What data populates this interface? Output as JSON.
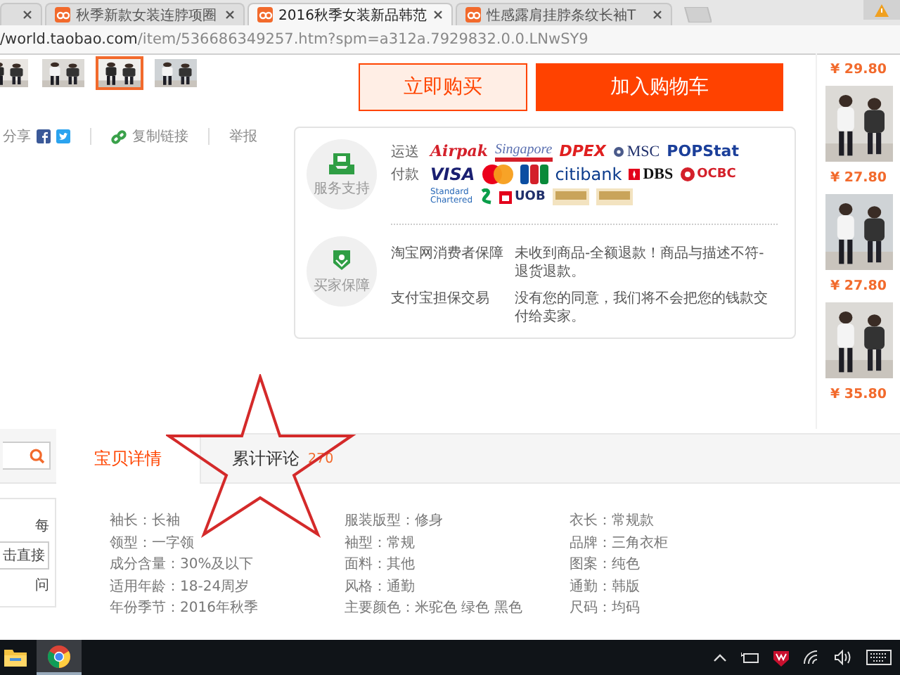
{
  "browser": {
    "tabs": [
      {
        "selected": false
      },
      {
        "label": "秋季新款女装连脖项圈",
        "selected": false
      },
      {
        "label": "2016秋季女装新品韩范",
        "selected": true
      },
      {
        "label": "性感露肩挂脖条纹长袖T",
        "selected": false
      }
    ],
    "address": {
      "host": "/world.taobao.com",
      "path": "/item/536686349257.htm?spm=a312a.7929832.0.0.LNwSY9"
    }
  },
  "thumbnails": [
    {
      "kind": "picture",
      "selected": false
    },
    {
      "kind": "picture",
      "selected": false
    },
    {
      "kind": "picture",
      "selected": true
    },
    {
      "kind": "picture",
      "selected": false
    }
  ],
  "share": {
    "label": "分享",
    "copy_link": "复制链接",
    "report": "举报"
  },
  "buy_buttons": [
    {
      "kind": "outline",
      "label": "立即购买"
    },
    {
      "kind": "solid",
      "label": "加入购物车"
    }
  ],
  "service": {
    "support_label": "服务支持",
    "shipping_label": "运送",
    "shipping_logos": [
      {
        "kind": "airpak",
        "label": "Airpak"
      },
      {
        "kind": "singapore",
        "label": "Singapore"
      },
      {
        "kind": "dpex",
        "label": "DPEX"
      },
      {
        "kind": "msc",
        "label": "MSC"
      },
      {
        "kind": "popstat",
        "label": "POPStat"
      }
    ],
    "payment_label": "付款",
    "payment_logos": [
      {
        "kind": "visa",
        "label": "VISA"
      },
      {
        "kind": "mastercard"
      },
      {
        "kind": "jcb"
      },
      {
        "kind": "citi",
        "label": "citibank"
      },
      {
        "kind": "dbs",
        "label": "DBS"
      },
      {
        "kind": "ocbc",
        "label": "OCBC"
      },
      {
        "kind": "chartered",
        "label": "Standard Chartered"
      },
      {
        "kind": "uob",
        "label": "UOB"
      },
      {
        "kind": "badge"
      },
      {
        "kind": "badge"
      }
    ],
    "guarantee_label": "买家保障",
    "guarantees": [
      {
        "name": "淘宝网消费者保障",
        "text": "未收到商品-全额退款！商品与描述不符-退货退款。"
      },
      {
        "name": "支付宝担保交易",
        "text": "没有您的同意，我们将不会把您的钱款交付给卖家。"
      }
    ]
  },
  "related": [
    {
      "kind": "price",
      "text": "¥ 29.80"
    },
    {
      "kind": "picture"
    },
    {
      "kind": "price",
      "text": "¥ 27.80"
    },
    {
      "kind": "picture"
    },
    {
      "kind": "price",
      "text": "¥ 27.80"
    },
    {
      "kind": "picture"
    },
    {
      "kind": "price",
      "text": "¥ 35.80"
    }
  ],
  "sidebar_fragments": [
    "每",
    "击直接",
    "问"
  ],
  "detail_tabs": [
    {
      "label": "宝贝详情",
      "selected": true
    },
    {
      "label": "累计评论",
      "count": "270",
      "selected": false
    }
  ],
  "attributes": [
    "袖长：长袖",
    "服装版型：修身",
    "衣长：常规款",
    "领型：一字领",
    "袖型：常规",
    "品牌：三角衣柜",
    "成分含量：30%及以下",
    "面料：其他",
    "图案：纯色",
    "适用年龄：18-24周岁",
    "风格：通勤",
    "通勤：韩版",
    "年份季节：2016年秋季",
    "主要颜色：米驼色 绿色 黑色",
    "尺码：均码"
  ]
}
